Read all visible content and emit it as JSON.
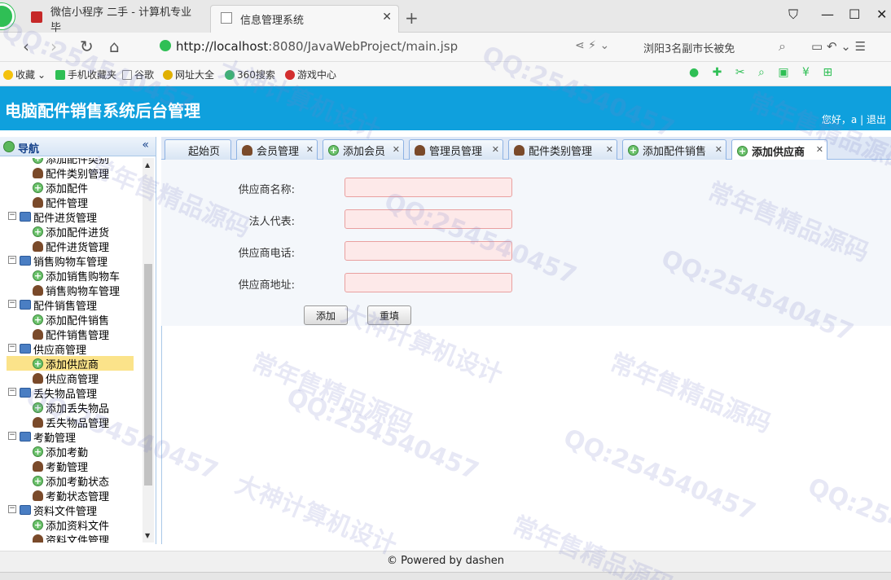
{
  "browser": {
    "tabs": [
      {
        "title": "微信小程序 二手 - 计算机专业毕",
        "active": false
      },
      {
        "title": "信息管理系统",
        "active": true
      }
    ],
    "url_host": "http://localhost",
    "url_rest": ":8080/JavaWebProject/main.jsp",
    "news": "浏阳3名副市长被免",
    "bookmarks": [
      "收藏",
      "手机收藏夹",
      "谷歌",
      "网址大全",
      "360搜索",
      "游戏中心"
    ]
  },
  "app": {
    "title": "电脑配件销售系统后台管理",
    "greeting": "您好，a",
    "logout": "退出",
    "separator": "|"
  },
  "nav": {
    "title": "导航",
    "collapse_glyph": "«",
    "items": [
      {
        "label": "添加配件类别",
        "type": "add",
        "level": 2
      },
      {
        "label": "配件类别管理",
        "type": "user",
        "level": 2
      },
      {
        "label": "添加配件",
        "type": "add",
        "level": 2
      },
      {
        "label": "配件管理",
        "type": "user",
        "level": 2
      },
      {
        "label": "配件进货管理",
        "type": "folder",
        "level": 1
      },
      {
        "label": "添加配件进货",
        "type": "add",
        "level": 2
      },
      {
        "label": "配件进货管理",
        "type": "user",
        "level": 2
      },
      {
        "label": "销售购物车管理",
        "type": "folder",
        "level": 1
      },
      {
        "label": "添加销售购物车",
        "type": "add",
        "level": 2
      },
      {
        "label": "销售购物车管理",
        "type": "user",
        "level": 2
      },
      {
        "label": "配件销售管理",
        "type": "folder",
        "level": 1
      },
      {
        "label": "添加配件销售",
        "type": "add",
        "level": 2
      },
      {
        "label": "配件销售管理",
        "type": "user",
        "level": 2
      },
      {
        "label": "供应商管理",
        "type": "folder",
        "level": 1
      },
      {
        "label": "添加供应商",
        "type": "add",
        "level": 2,
        "selected": true
      },
      {
        "label": "供应商管理",
        "type": "user",
        "level": 2
      },
      {
        "label": "丢失物品管理",
        "type": "folder",
        "level": 1
      },
      {
        "label": "添加丢失物品",
        "type": "add",
        "level": 2
      },
      {
        "label": "丢失物品管理",
        "type": "user",
        "level": 2
      },
      {
        "label": "考勤管理",
        "type": "folder",
        "level": 1
      },
      {
        "label": "添加考勤",
        "type": "add",
        "level": 2
      },
      {
        "label": "考勤管理",
        "type": "user",
        "level": 2
      },
      {
        "label": "添加考勤状态",
        "type": "add",
        "level": 2
      },
      {
        "label": "考勤状态管理",
        "type": "user",
        "level": 2
      },
      {
        "label": "资料文件管理",
        "type": "folder",
        "level": 1
      },
      {
        "label": "添加资料文件",
        "type": "add",
        "level": 2
      },
      {
        "label": "资料文件管理",
        "type": "user",
        "level": 2
      }
    ]
  },
  "tabs": [
    {
      "label": "起始页",
      "icon": "none",
      "closable": false
    },
    {
      "label": "会员管理",
      "icon": "user",
      "closable": true
    },
    {
      "label": "添加会员",
      "icon": "add",
      "closable": true
    },
    {
      "label": "管理员管理",
      "icon": "user",
      "closable": true
    },
    {
      "label": "配件类别管理",
      "icon": "user",
      "closable": true
    },
    {
      "label": "添加配件销售",
      "icon": "add",
      "closable": true
    },
    {
      "label": "添加供应商",
      "icon": "add",
      "closable": true,
      "active": true
    }
  ],
  "form": {
    "fields": [
      {
        "label": "供应商名称:",
        "value": ""
      },
      {
        "label": "法人代表:",
        "value": ""
      },
      {
        "label": "供应商电话:",
        "value": ""
      },
      {
        "label": "供应商地址:",
        "value": ""
      }
    ],
    "submit_label": "添加",
    "reset_label": "重填"
  },
  "footer": {
    "text": "© Powered by dashen"
  },
  "watermarks": [
    "QQ:254540457",
    "大神计算机设计",
    "常年售精品源码"
  ],
  "colors": {
    "header_bg": "#0fa0dd",
    "input_bg": "#fde9e9",
    "input_border": "#e9a0a0",
    "selected_bg": "#fbe38a"
  }
}
